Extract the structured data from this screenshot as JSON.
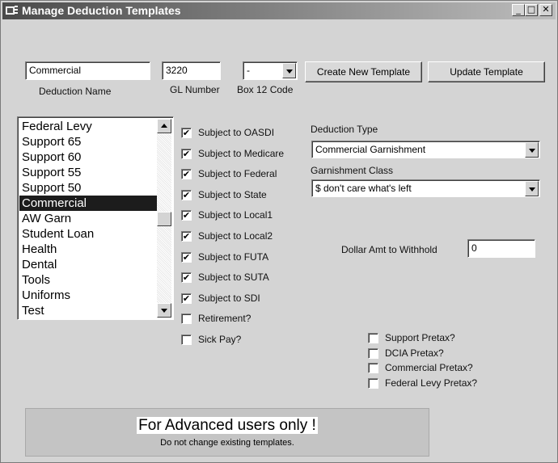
{
  "window": {
    "title": "Manage Deduction Templates",
    "controls": {
      "minimize": "_",
      "maximize": "□",
      "close": "✕"
    }
  },
  "deduction_name": {
    "value": "Commercial",
    "label": "Deduction Name"
  },
  "gl_number": {
    "value": "3220",
    "label": "GL Number"
  },
  "box12": {
    "value": "-",
    "label": "Box 12 Code"
  },
  "buttons": {
    "create": "Create New Template",
    "update": "Update Template"
  },
  "templates": {
    "items": [
      "Federal Levy",
      "Support 65",
      "Support 60",
      "Support 55",
      "Support 50",
      "Commercial",
      "AW Garn",
      "Student Loan",
      "Health",
      "Dental",
      "Tools",
      "Uniforms",
      "Test"
    ],
    "selected": "Commercial"
  },
  "subject_checks": [
    {
      "label": "Subject to OASDI",
      "checked": true
    },
    {
      "label": "Subject to Medicare",
      "checked": true
    },
    {
      "label": "Subject to Federal",
      "checked": true
    },
    {
      "label": "Subject to State",
      "checked": true
    },
    {
      "label": "Subject to Local1",
      "checked": true
    },
    {
      "label": "Subject to Local2",
      "checked": true
    },
    {
      "label": "Subject to FUTA",
      "checked": true
    },
    {
      "label": "Subject to SUTA",
      "checked": true
    },
    {
      "label": "Subject to SDI",
      "checked": true
    },
    {
      "label": "Retirement?",
      "checked": false
    },
    {
      "label": "Sick Pay?",
      "checked": false
    }
  ],
  "deduction_type": {
    "label": "Deduction Type",
    "value": "Commercial Garnishment"
  },
  "garnishment_class": {
    "label": "Garnishment Class",
    "value": "$ don't care what's left"
  },
  "dollar_amt": {
    "label": "Dollar Amt to Withhold",
    "value": "0"
  },
  "pretax_checks": [
    {
      "label": "Support Pretax?",
      "checked": false
    },
    {
      "label": "DCIA Pretax?",
      "checked": false
    },
    {
      "label": "Commercial Pretax?",
      "checked": false
    },
    {
      "label": "Federal Levy Pretax?",
      "checked": false
    }
  ],
  "advanced": {
    "title": "For Advanced users only !",
    "subtitle": "Do not change existing templates."
  },
  "check_mark": "✔"
}
